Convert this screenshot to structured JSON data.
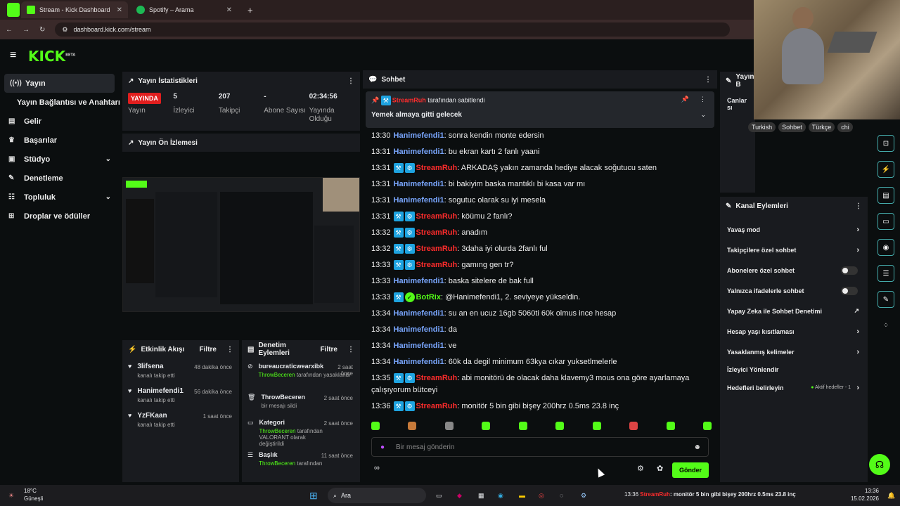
{
  "browser": {
    "tabs": [
      {
        "label": "Stream - Kick Dashboard"
      },
      {
        "label": "Spotify – Arama"
      }
    ],
    "url": "dashboard.kick.com/stream"
  },
  "header": {
    "logo": "KICK",
    "beta": "BETA"
  },
  "sidebar": {
    "items": [
      {
        "label": "Yayın"
      },
      {
        "label": "Yayın Bağlantısı ve Anahtarı"
      },
      {
        "label": "Gelir"
      },
      {
        "label": "Başarılar"
      },
      {
        "label": "Stüdyo"
      },
      {
        "label": "Denetleme"
      },
      {
        "label": "Topluluk"
      },
      {
        "label": "Droplar ve ödüller"
      }
    ]
  },
  "stats_panel": {
    "title": "Yayın İstatistikleri",
    "live_badge": "YAYINDA",
    "stats": [
      {
        "value": "",
        "label": "Yayın"
      },
      {
        "value": "5",
        "label": "İzleyici"
      },
      {
        "value": "207",
        "label": "Takipçi"
      },
      {
        "value": "-",
        "label": "Abone Sayısı"
      },
      {
        "value": "02:34:56",
        "label": "Yayında Olduğu"
      }
    ]
  },
  "preview_panel": {
    "title": "Yayın Ön İzlemesi"
  },
  "activity": {
    "title": "Etkinlik Akışı",
    "filter": "Filtre",
    "items": [
      {
        "name": "3lifsena",
        "sub": "kanalı takip etti",
        "time": "48 dakika önce"
      },
      {
        "name": "Hanimefendi1",
        "sub": "kanalı takip etti",
        "time": "56 dakika önce"
      },
      {
        "name": "YzFKaan",
        "sub": "kanalı takip etti",
        "time": "1 saat önce"
      }
    ]
  },
  "moderation": {
    "title": "Denetim Eylemleri",
    "filter": "Filtre",
    "items": [
      {
        "name": "bureaucraticwearxibk",
        "actor": "ThrowBeceren",
        "action": "tarafından yasaklandı",
        "time": "2 saat önce"
      },
      {
        "name": "ThrowBeceren",
        "actor": "",
        "action": "bir mesajı sildi",
        "time": "2 saat önce"
      },
      {
        "name": "Kategori",
        "actor": "ThrowBeceren",
        "action": "tarafından VALORANT olarak değiştirildi",
        "time": "2 saat önce"
      },
      {
        "name": "Başlık",
        "actor": "ThrowBeceren",
        "action": "tarafından",
        "time": "11 saat önce"
      }
    ]
  },
  "chat": {
    "title": "Sohbet",
    "pinned_by": "StreamRuh",
    "pinned_suffix": "tarafından sabitlendi",
    "pinned_text": "Yemek almaya gitti gelecek",
    "messages": [
      {
        "time": "13:30",
        "user": "Hanimefendi1",
        "type": "u1",
        "text": "sonra kendin monte edersin"
      },
      {
        "time": "13:31",
        "user": "Hanimefendi1",
        "type": "u1",
        "text": "bu ekran kartı 2 fanlı yaani"
      },
      {
        "time": "13:31",
        "user": "StreamRuh",
        "type": "u2",
        "text": "ARKADAŞ yakın zamanda hediye alacak soğutucu saten"
      },
      {
        "time": "13:31",
        "user": "Hanimefendi1",
        "type": "u1",
        "text": "bi bakiyim baska mantıklı bi kasa var mı"
      },
      {
        "time": "13:31",
        "user": "Hanimefendi1",
        "type": "u1",
        "text": "sogutuc olarak su iyi mesela"
      },
      {
        "time": "13:31",
        "user": "StreamRuh",
        "type": "u2",
        "text": "köümu 2 fanlı?"
      },
      {
        "time": "13:32",
        "user": "StreamRuh",
        "type": "u2",
        "text": "anadım"
      },
      {
        "time": "13:32",
        "user": "StreamRuh",
        "type": "u2",
        "text": "3daha iyi olurda 2fanlı ful"
      },
      {
        "time": "13:33",
        "user": "StreamRuh",
        "type": "u2",
        "text": "gamıng gen tr?"
      },
      {
        "time": "13:33",
        "user": "Hanimefendi1",
        "type": "u1",
        "text": "baska sitelere de bak full"
      },
      {
        "time": "13:33",
        "user": "BotRix",
        "type": "u3",
        "text": "@Hanimefendi1, 2. seviyeye yükseldin."
      },
      {
        "time": "13:34",
        "user": "Hanimefendi1",
        "type": "u1",
        "text": "su an en ucuz 16gb 5060ti 60k olmus ince hesap"
      },
      {
        "time": "13:34",
        "user": "Hanimefendi1",
        "type": "u1",
        "text": "da"
      },
      {
        "time": "13:34",
        "user": "Hanimefendi1",
        "type": "u1",
        "text": "ve"
      },
      {
        "time": "13:34",
        "user": "Hanimefendi1",
        "type": "u1",
        "text": "60k da degil minimum 63kya cıkar yuksetlmelerle"
      },
      {
        "time": "13:35",
        "user": "StreamRuh",
        "type": "u2",
        "text": "abi monitörü de olacak daha klavemy3 mous ona göre ayarlamaya çalışıyorum bütceyi"
      },
      {
        "time": "13:36",
        "user": "StreamRuh",
        "type": "u2",
        "text": "monitör 5 bin gibi bişey 200hrz 0.5ms 23.8 inç"
      }
    ],
    "input_placeholder": "Bir mesaj gönderin",
    "send_label": "Gönder"
  },
  "live_panel": {
    "title": "Yayın B",
    "canlar": "Canlar sı",
    "tags": [
      "Turkish",
      "Sohbet",
      "Türkçe",
      "chi"
    ]
  },
  "channel_actions": {
    "title": "Kanal Eylemleri",
    "items": [
      {
        "label": "Yavaş mod",
        "control": "chev"
      },
      {
        "label": "Takipçilere özel sohbet",
        "control": "chev"
      },
      {
        "label": "Abonelere özel sohbet",
        "control": "toggle"
      },
      {
        "label": "Yalnızca ifadelerle sohbet",
        "control": "toggle"
      },
      {
        "label": "Yapay Zeka ile Sohbet Denetimi",
        "control": "ext"
      },
      {
        "label": "Hesap yaşı kısıtlaması",
        "control": "chev"
      },
      {
        "label": "Yasaklanmış kelimeler",
        "control": "chev"
      },
      {
        "label": "İzleyici Yönlendir",
        "control": "none"
      },
      {
        "label": "Hedefleri belirleyin",
        "control": "chev"
      }
    ],
    "active_goals": "Aktif hedefler - 1"
  },
  "taskbar": {
    "weather_temp": "18°C",
    "weather_label": "Güneşli",
    "search": "Ara",
    "ticker_time": "13:36",
    "ticker_user": "StreamRuh",
    "ticker_text": "monitör 5 bin gibi bişey 200hrz 0.5ms 23.8 inç",
    "clock_time": "13:36",
    "clock_date": "15.02.2026"
  },
  "colors": {
    "brand": "#53fc18",
    "live": "#e01e1e",
    "user1": "#7aa7ff",
    "user2": "#ff2c2c"
  }
}
